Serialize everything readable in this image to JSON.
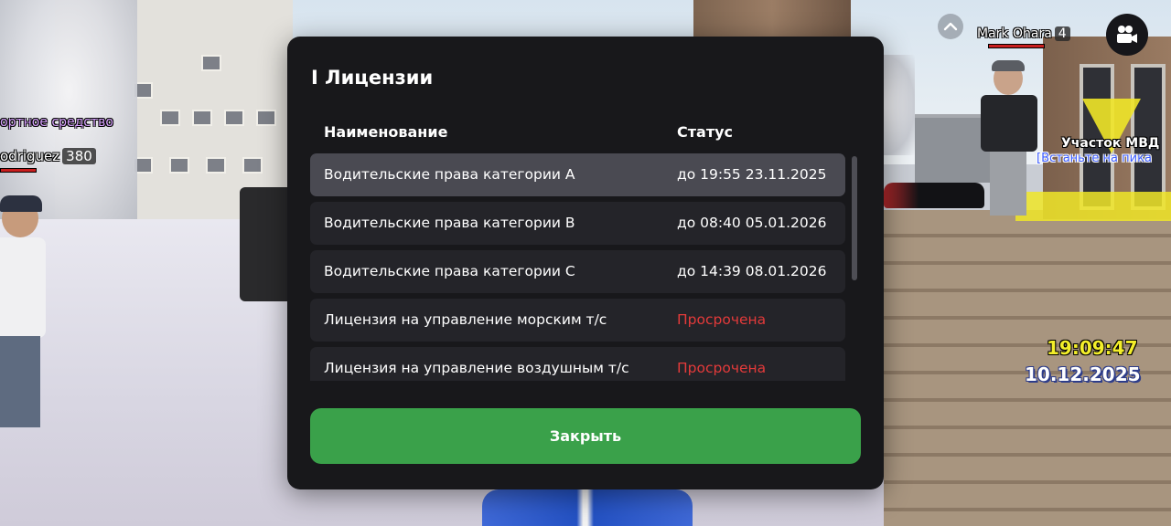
{
  "hud": {
    "vehicle_label": "ортное средство",
    "player_left_name": "odriguez",
    "player_left_level": "380",
    "player_right_name": "Mark Ohara",
    "player_right_level": "4",
    "marker_title": "Участок МВД",
    "marker_subtitle": "[Встаньте на пика",
    "time": "19:09:47",
    "date": "10.12.2025",
    "icons": [
      "chevron-up-icon",
      "video-camera-icon"
    ]
  },
  "modal": {
    "title": "I Лицензии",
    "columns": {
      "name": "Наименование",
      "status": "Статус"
    },
    "rows": [
      {
        "name": "Водительские права категории A",
        "status": "до 19:55 23.11.2025",
        "expired": false,
        "selected": true
      },
      {
        "name": "Водительские права категории B",
        "status": "до 08:40 05.01.2026",
        "expired": false,
        "selected": false
      },
      {
        "name": "Водительские права категории C",
        "status": "до 14:39 08.01.2026",
        "expired": false,
        "selected": false
      },
      {
        "name": "Лицензия на управление морским т/с",
        "status": "Просрочена",
        "expired": true,
        "selected": false
      },
      {
        "name": "Лицензия на управление воздушным т/с",
        "status": "Просрочена",
        "expired": true,
        "selected": false
      }
    ],
    "close_label": "Закрыть"
  },
  "colors": {
    "modal_bg": "#18181b",
    "row_bg": "#242429",
    "row_selected_bg": "#4a4a52",
    "expired": "#e33a3a",
    "close_button": "#3aa14a",
    "clock_time": "#f3ee2a"
  }
}
